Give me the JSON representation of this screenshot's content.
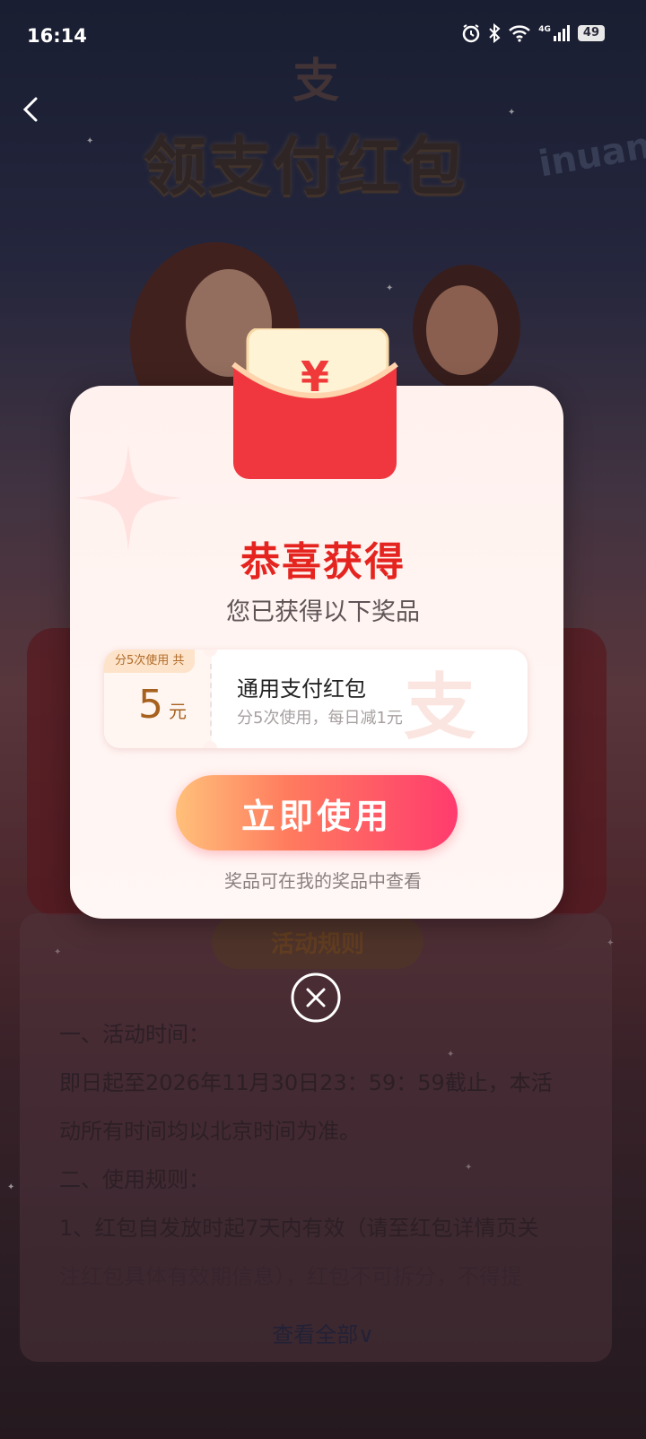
{
  "status_bar": {
    "time": "16:14",
    "network": "4G",
    "battery": "49"
  },
  "page": {
    "logo_char": "支",
    "title": "领支付红包",
    "sign_text": "inuan"
  },
  "modal": {
    "title": "恭喜获得",
    "subtitle": "您已获得以下奖品",
    "envelope_symbol": "¥",
    "coupon": {
      "tag": "分5次使用 共",
      "amount": "5",
      "unit": "元",
      "name": "通用支付红包",
      "desc": "分5次使用，每日减1元",
      "watermark": "支"
    },
    "cta": "立即使用",
    "hint": "奖品可在我的奖品中查看"
  },
  "rules": {
    "title": "活动规则",
    "lines": [
      "一、活动时间：",
      "即日起至2026年11月30日23：59：59截止，本活",
      "动所有时间均以北京时间为准。",
      "二、使用规则：",
      "1、红包自发放时起7天内有效（请至红包详情页关",
      "注红包具体有效期信息），红包不可拆分，不得提"
    ],
    "view_all": "查看全部"
  }
}
